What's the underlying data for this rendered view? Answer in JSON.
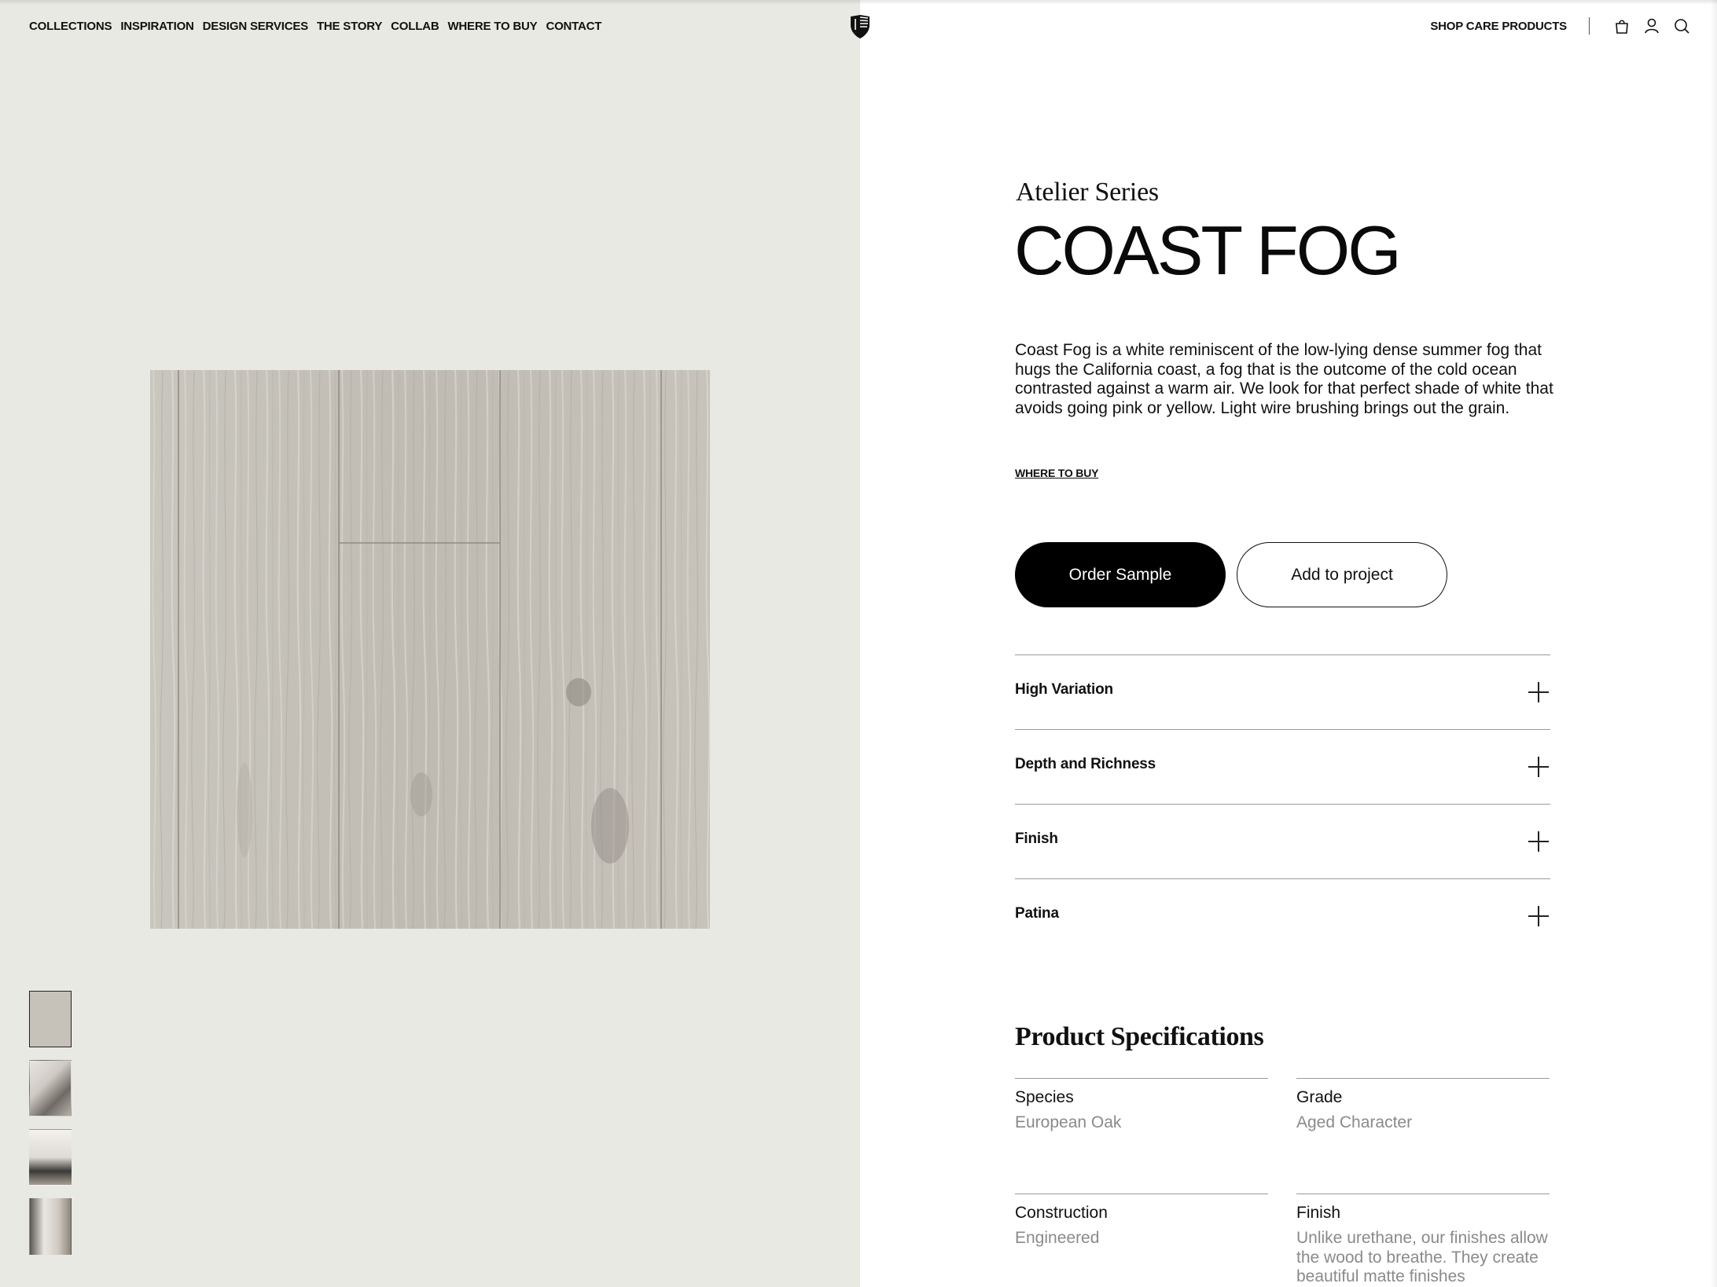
{
  "nav": {
    "left_items": [
      "COLLECTIONS",
      "INSPIRATION",
      "DESIGN SERVICES",
      "THE STORY",
      "COLLAB",
      "WHERE TO BUY",
      "CONTACT"
    ],
    "shop_care": "SHOP CARE PRODUCTS",
    "icons": [
      "shield-logo",
      "bag-icon",
      "account-icon",
      "search-icon"
    ]
  },
  "product": {
    "series": "Atelier Series",
    "name": "COAST FOG",
    "description": "Coast Fog is a white reminiscent of the low-lying dense summer fog that hugs the California coast, a fog that is the outcome of the cold ocean contrasted against a warm air. We look for that perfect shade of white that avoids going pink or yellow. Light wire brushing brings out the grain.",
    "where_to_buy": "WHERE TO BUY",
    "order_sample": "Order Sample",
    "add_to_project": "Add to project"
  },
  "accordion": [
    {
      "label": "High Variation"
    },
    {
      "label": "Depth and Richness"
    },
    {
      "label": "Finish"
    },
    {
      "label": "Patina"
    }
  ],
  "specs": {
    "title": "Product Specifications",
    "items": [
      {
        "label": "Species",
        "value": "European Oak"
      },
      {
        "label": "Grade",
        "value": "Aged Character"
      },
      {
        "label": "Construction",
        "value": "Engineered"
      },
      {
        "label": "Finish",
        "value": "Unlike urethane, our finishes allow the wood to breathe. They create beautiful matte finishes"
      }
    ]
  },
  "colors": {
    "left_background": "#e9e9e4",
    "wood_base": "#c5c1b9",
    "button_primary": "#000000"
  }
}
